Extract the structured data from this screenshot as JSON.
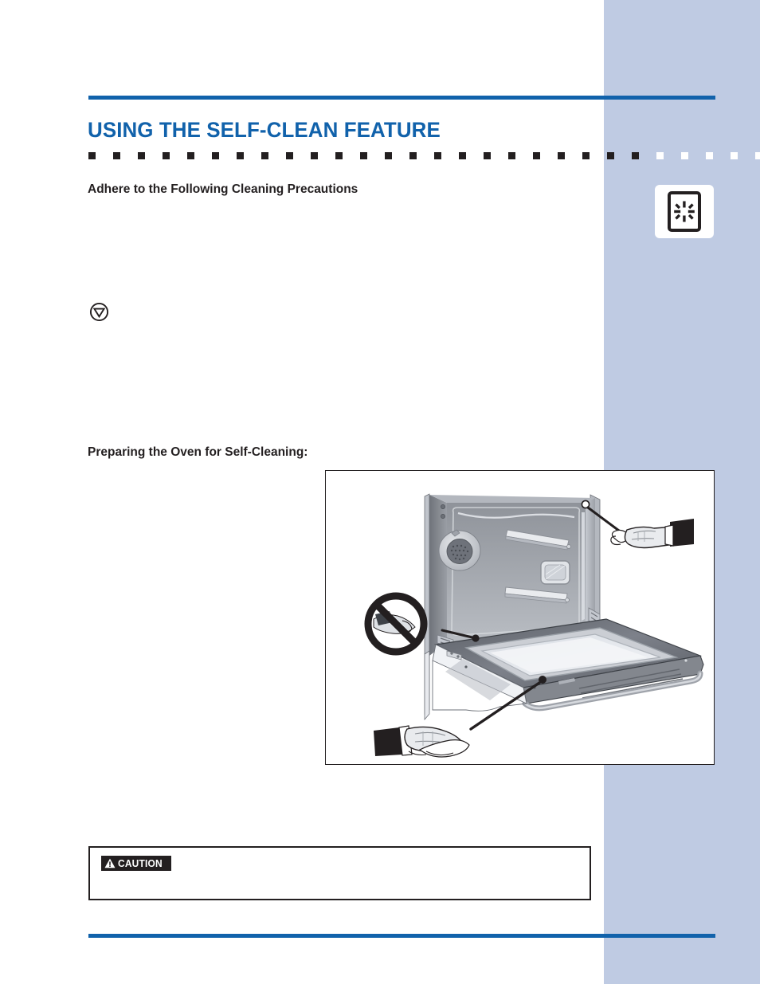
{
  "page": {
    "background_color": "#ffffff",
    "sidebar_color": "#bfcbe3",
    "accent_color": "#1162ab",
    "ink_color": "#231f20"
  },
  "header": {
    "title": "USING THE SELF-CLEAN FEATURE",
    "divider_dot_count_dark": 23,
    "divider_dot_count_light": 6
  },
  "sections": {
    "precautions_heading": "Adhere to the Following Cleaning Precautions",
    "preparing_heading": "Preparing the Oven for Self-Cleaning:"
  },
  "icons": {
    "feature_badge": "self-clean-burst-icon",
    "prohibition": "do-not-triangle-icon",
    "caution_alert": "warning-triangle-icon"
  },
  "caution": {
    "label": "CAUTION",
    "body": ""
  },
  "illustration": {
    "name": "oven-self-clean-preparation-diagram",
    "caption": "",
    "callouts": [
      {
        "name": "door-gasket-callout",
        "label": ""
      },
      {
        "name": "door-liner-callout",
        "label": ""
      },
      {
        "name": "do-not-clean-gasket-callout",
        "label": ""
      }
    ]
  },
  "body_text": {
    "precautions_paragraph": "",
    "prohibition_paragraph": "",
    "preparing_paragraph": ""
  }
}
